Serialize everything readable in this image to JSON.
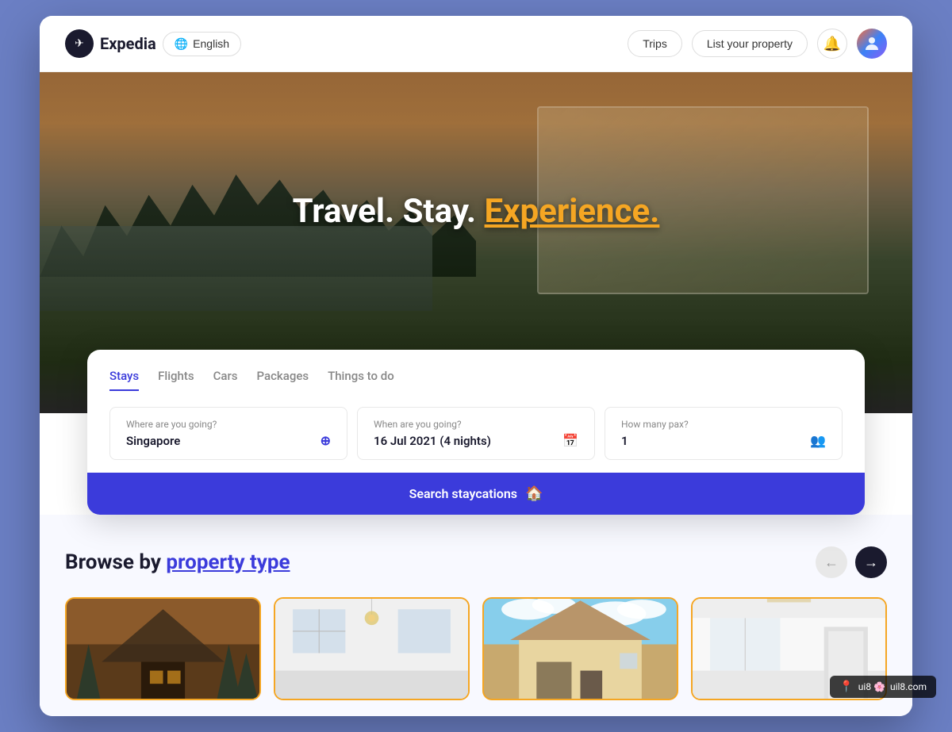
{
  "brand": {
    "name": "Expedia",
    "icon": "✈"
  },
  "nav": {
    "language_label": "English",
    "language_icon": "🌐",
    "trips_label": "Trips",
    "list_property_label": "List your property",
    "notification_icon": "🔔",
    "avatar_icon": "👤"
  },
  "hero": {
    "title_part1": "Travel. Stay. ",
    "title_highlight": "Experience.",
    "title_highlight_color": "#f5a623"
  },
  "search": {
    "tabs": [
      {
        "id": "stays",
        "label": "Stays",
        "active": true
      },
      {
        "id": "flights",
        "label": "Flights",
        "active": false
      },
      {
        "id": "cars",
        "label": "Cars",
        "active": false
      },
      {
        "id": "packages",
        "label": "Packages",
        "active": false
      },
      {
        "id": "things",
        "label": "Things to do",
        "active": false
      }
    ],
    "destination_label": "Where are you going?",
    "destination_value": "Singapore",
    "date_label": "When are you going?",
    "date_value": "16 Jul 2021 (4 nights)",
    "pax_label": "How many pax?",
    "pax_value": "1",
    "search_button_label": "Search staycations",
    "search_icon": "🏠",
    "button_color": "#3b3bdb"
  },
  "browse": {
    "title_part1": "Browse by ",
    "title_highlight": "property type",
    "prev_icon": "←",
    "next_icon": "→",
    "cards": [
      {
        "id": "card1",
        "type": "cabin"
      },
      {
        "id": "card2",
        "type": "apartment"
      },
      {
        "id": "card3",
        "type": "house"
      },
      {
        "id": "card4",
        "type": "studio"
      }
    ]
  },
  "watermark": {
    "icon": "📍",
    "text": "ui8.com",
    "subtext": "uil8.com"
  }
}
